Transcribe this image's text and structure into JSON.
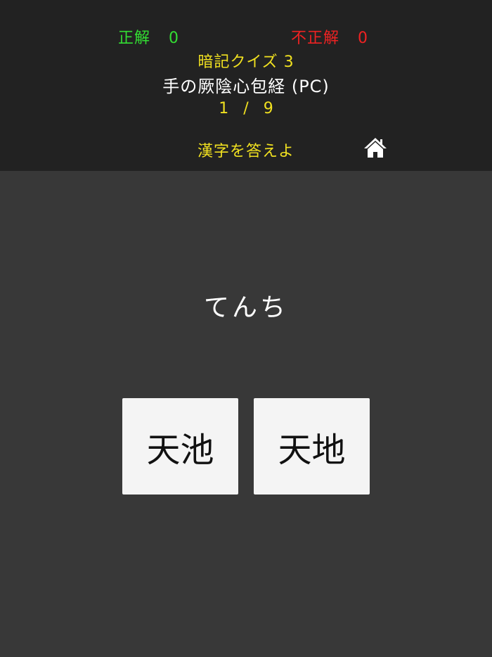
{
  "score": {
    "correct_label": "正解",
    "correct_count": "0",
    "wrong_label": "不正解",
    "wrong_count": "0"
  },
  "quiz": {
    "name": "暗記クイズ 3",
    "meridian": "手の厥陰心包経 (PC)",
    "progress": "1 / 9",
    "instruction": "漢字を答えよ"
  },
  "question": {
    "reading": "てんち"
  },
  "choices": [
    {
      "label": "天池"
    },
    {
      "label": "天地"
    }
  ],
  "icons": {
    "home": "home-icon"
  },
  "colors": {
    "correct": "#33dd33",
    "wrong": "#ee2222",
    "accent": "#f0e020",
    "header_bg": "#222222",
    "body_bg": "#383838",
    "card_bg": "#f4f4f4"
  }
}
